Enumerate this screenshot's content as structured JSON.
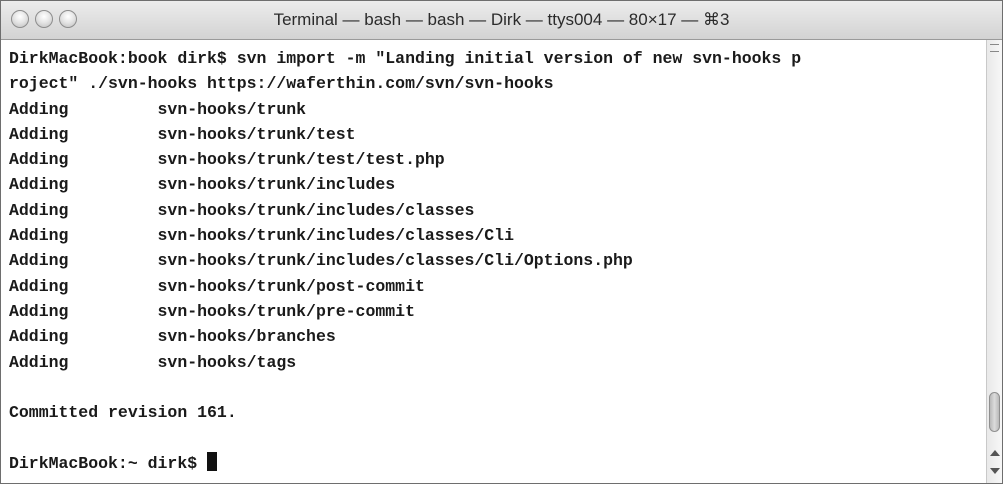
{
  "window": {
    "title": "Terminal — bash — bash — Dirk — ttys004 — 80×17 — ⌘3"
  },
  "terminal": {
    "lines": [
      "DirkMacBook:book dirk$ svn import -m \"Landing initial version of new svn-hooks p",
      "roject\" ./svn-hooks https://waferthin.com/svn/svn-hooks",
      "Adding         svn-hooks/trunk",
      "Adding         svn-hooks/trunk/test",
      "Adding         svn-hooks/trunk/test/test.php",
      "Adding         svn-hooks/trunk/includes",
      "Adding         svn-hooks/trunk/includes/classes",
      "Adding         svn-hooks/trunk/includes/classes/Cli",
      "Adding         svn-hooks/trunk/includes/classes/Cli/Options.php",
      "Adding         svn-hooks/trunk/post-commit",
      "Adding         svn-hooks/trunk/pre-commit",
      "Adding         svn-hooks/branches",
      "Adding         svn-hooks/tags",
      "",
      "Committed revision 161.",
      ""
    ],
    "prompt": "DirkMacBook:~ dirk$ "
  }
}
